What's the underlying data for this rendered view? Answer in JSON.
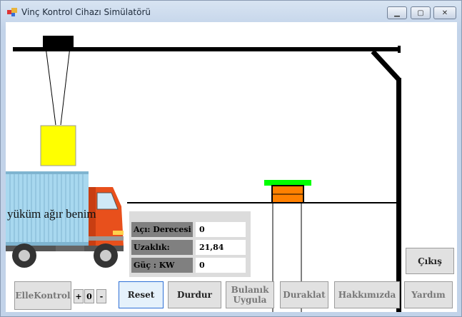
{
  "window": {
    "title": "Vinç Kontrol Cihazı Simülatörü"
  },
  "scene": {
    "truck_text": "yüküm ağır benim"
  },
  "panel": {
    "rows": [
      {
        "label": "Açı: Derecesi",
        "value": "0"
      },
      {
        "label": "Uzaklık:",
        "value": "21,84"
      },
      {
        "label": "Güç : KW",
        "value": "0"
      }
    ]
  },
  "buttons": {
    "cikis": "Çıkış",
    "elle_kontrol": "ElleKontrol",
    "plus": "+",
    "zero": "0",
    "minus": "-",
    "reset": "Reset",
    "durdur": "Durdur",
    "bulanik_1": "Bulanık",
    "bulanik_2": "Uygula",
    "duraklat": "Duraklat",
    "hakkimizda": "Hakkımızda",
    "yardim": "Yardım"
  },
  "colors": {
    "load": "#ffff00",
    "target_top": "#00ff00",
    "target_body": "#ff8000",
    "truck_cab": "#e8501c",
    "container": "#a8d8ef"
  }
}
